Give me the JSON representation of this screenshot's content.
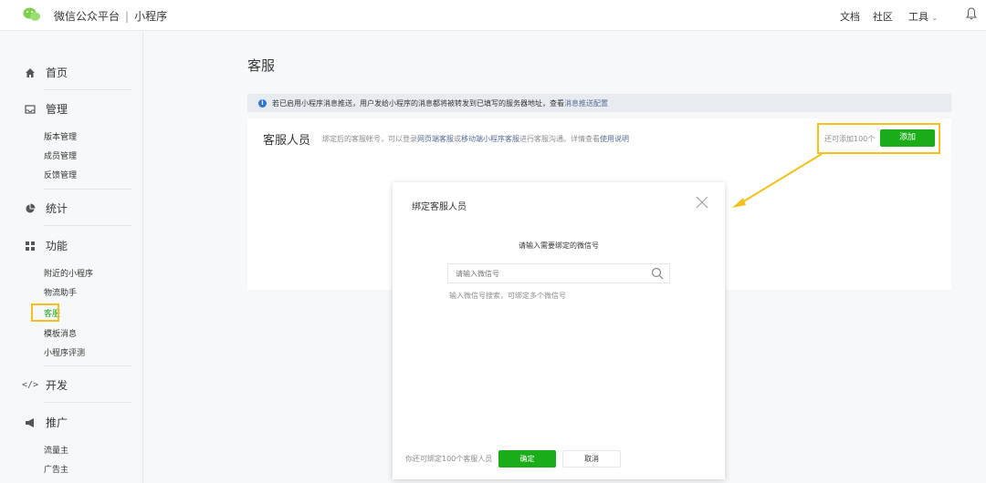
{
  "header": {
    "brand": "微信公众平台",
    "separator": "|",
    "product": "小程序",
    "links": {
      "docs": "文档",
      "community": "社区",
      "tools": "工具"
    }
  },
  "sidebar": {
    "home": "首页",
    "manage": "管理",
    "manage_items": [
      "版本管理",
      "成员管理",
      "反馈管理"
    ],
    "stats": "统计",
    "features": "功能",
    "feature_items": [
      "附近的小程序",
      "物流助手",
      "客服",
      "模板消息",
      "小程序评测"
    ],
    "develop": "开发",
    "promote": "推广",
    "promote_items": [
      "流量主",
      "广告主"
    ]
  },
  "main": {
    "title": "客服",
    "notice": {
      "text": "若已启用小程序消息推送，用户发给小程序的消息都将被转发到已填写的服务器地址，查看",
      "link": "消息推送配置"
    },
    "cs": {
      "label": "客服人员",
      "desc_pre": "绑定后的客服帐号，可以登录",
      "link1": "网页端客服",
      "mid": "或",
      "link2": "移动端小程序客服",
      "desc_post": "进行客服沟通。详情查看",
      "link3": "使用说明"
    },
    "add_hint": "还可添加100个",
    "add_button": "添加"
  },
  "modal": {
    "title": "绑定客服人员",
    "prompt": "请输入需要绑定的微信号",
    "placeholder": "请输入微信号",
    "help": "输入微信号搜索，可绑定多个微信号",
    "footer_text": "你还可绑定100个客服人员",
    "ok": "确定",
    "cancel": "取消"
  },
  "colors": {
    "accent": "#1aad19",
    "highlight": "#f5c01c",
    "link": "#576b95"
  }
}
